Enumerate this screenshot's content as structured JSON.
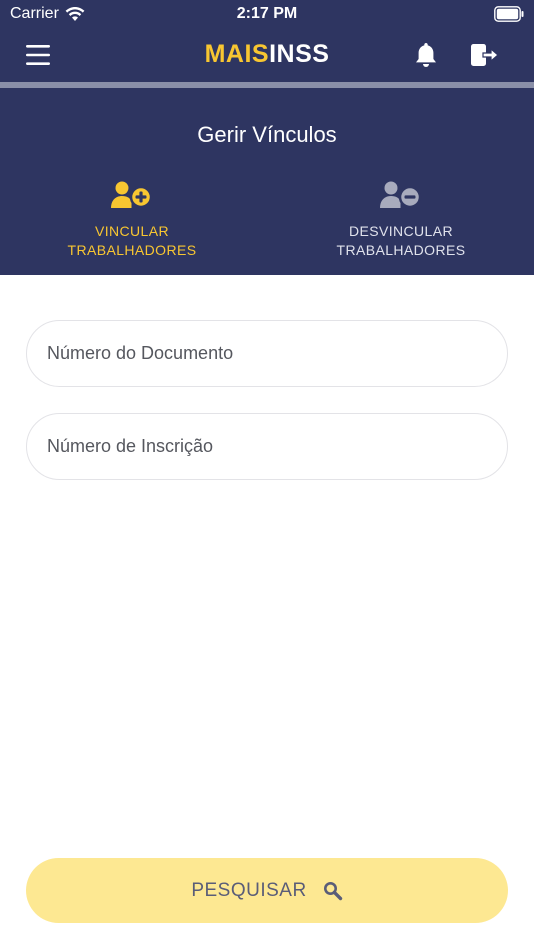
{
  "status_bar": {
    "carrier": "Carrier",
    "time": "2:17 PM"
  },
  "navbar": {
    "logo_part1": "MAIS",
    "logo_part2": "INSS",
    "icons": [
      "menu-icon",
      "bell-icon",
      "logout-icon"
    ]
  },
  "header": {
    "title": "Gerir Vínculos"
  },
  "tabs": [
    {
      "label": "VINCULAR\nTRABALHADORES",
      "icon": "user-plus-icon",
      "active": true
    },
    {
      "label": "DESVINCULAR\nTRABALHADORES",
      "icon": "user-minus-icon",
      "active": false
    }
  ],
  "form": {
    "document_placeholder": "Número do Documento",
    "document_value": "",
    "inscription_placeholder": "Número de Inscrição",
    "inscription_value": ""
  },
  "search_button": {
    "label": "PESQUISAR",
    "icon": "search-icon"
  },
  "colors": {
    "primary": "#2e3561",
    "accent": "#f8c631",
    "button": "#fde892"
  }
}
